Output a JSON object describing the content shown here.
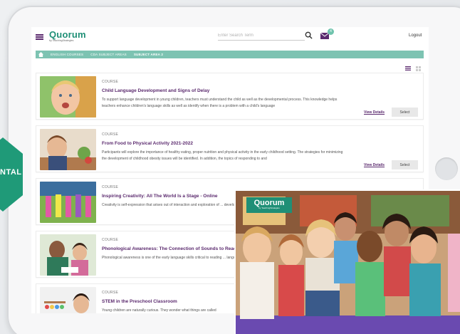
{
  "header": {
    "logo_name": "Quorum",
    "logo_sub": "by TeachingStrategies",
    "search_placeholder": "Enter Search Term",
    "mail_count": "4",
    "logout_label": "Logout"
  },
  "breadcrumb": [
    "ENGLISH COURSES",
    "CDA SUBJECT AREAS",
    "SUBJECT AREA 2"
  ],
  "side_badge_text": "NTAL",
  "courses": [
    {
      "kind": "COURSE",
      "title": "Child Language Development and Signs of Delay",
      "desc": "To support language development in young children, teachers must understand the child as well as the developmental process. This knowledge helps teachers enhance children's language skills as well as identify when there is a problem with a child's language",
      "view_details": "View Details",
      "select": "Select"
    },
    {
      "kind": "COURSE",
      "title": "From Food to Physical Activity 2021-2022",
      "desc": "Participants will explore the importance of healthy eating, proper nutrition and physical activity in the early childhood setting. The strategies for minimizing the development of childhood obesity issues will be identified. In addition, the topics of responding to and",
      "view_details": "View Details",
      "select": "Select"
    },
    {
      "kind": "COURSE",
      "title": "Inspiring Creativity: All The World Is a Stage - Online",
      "desc": "Creativity is self-expression that arises out of interaction and exploration of ... develops through playful experiences, rather than concern for the finished"
    },
    {
      "kind": "COURSE",
      "title": "Phonological Awareness: The Connection of Sounds to Reading",
      "desc": "Phonological awareness is one of the early language skills critical to reading ... language. In order for teachers to effectively support the development of p"
    },
    {
      "kind": "COURSE",
      "title": "STEM in the Preschool Classroom",
      "desc": "Young children are naturally curious. They wonder what things are called"
    }
  ],
  "overlay": {
    "logo_name": "Quorum",
    "logo_sub": "by TeachingStrategies"
  },
  "colors": {
    "brand_teal": "#1f8f76",
    "breadcrumb_bg": "#7dc3b2",
    "title_purple": "#5b2a6e",
    "badge_green": "#1f9a78"
  }
}
